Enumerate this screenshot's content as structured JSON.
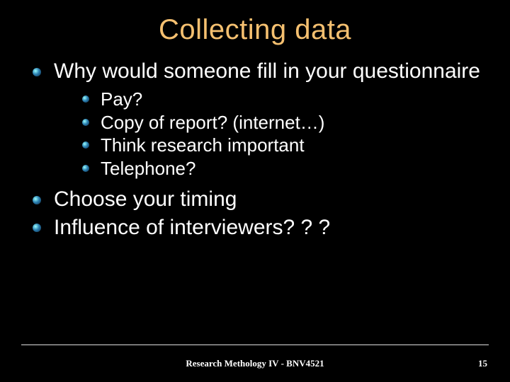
{
  "title": "Collecting data",
  "bullets": {
    "b0": "Why would someone fill in your questionnaire",
    "b0_sub": {
      "s0": "Pay?",
      "s1": "Copy of report? (internet…)",
      "s2": "Think research important",
      "s3": "Telephone?"
    },
    "b1": "Choose your timing",
    "b2": "Influence of interviewers? ? ?"
  },
  "footer": "Research Methology IV - BNV4521",
  "page": "15"
}
